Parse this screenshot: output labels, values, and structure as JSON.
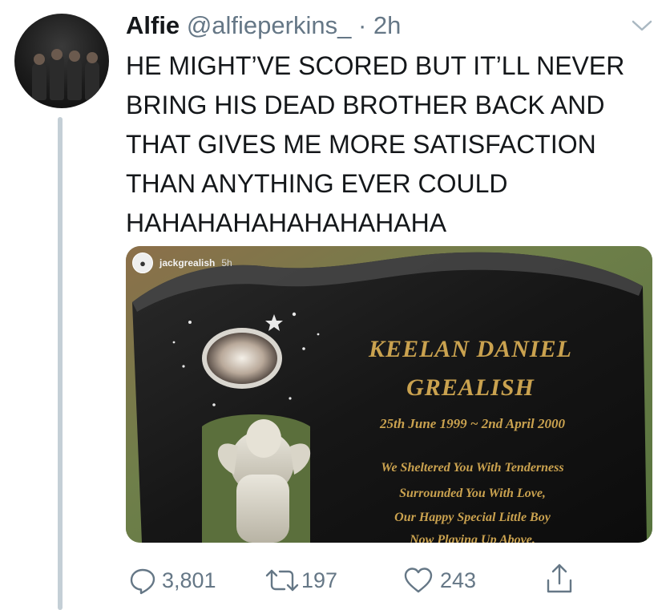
{
  "tweet": {
    "display_name": "Alfie",
    "handle": "@alfieperkins_",
    "separator": "·",
    "time": "2h",
    "text": "HE MIGHT’VE SCORED BUT IT’LL NEVER\nBRING HIS DEAD BROTHER BACK AND\nTHAT GIVES ME MORE SATISFACTION\nTHAN ANYTHING EVER COULD\nHAHAHAHAHAHAHAHAHA"
  },
  "media": {
    "instagram_user": "jackgrealish",
    "instagram_time": "5h",
    "stone": {
      "name_line1": "KEELAN DANIEL",
      "name_line2": "GREALISH",
      "dates": "25th June 1999 ~ 2nd April 2000",
      "verse1": "We Sheltered You With Tenderness",
      "verse2": "Surrounded You With Love,",
      "verse3": "Our Happy Special Little Boy",
      "verse4": "Now Playing Up Above."
    }
  },
  "actions": {
    "replies": "3,801",
    "retweets": "197",
    "likes": "243"
  },
  "colors": {
    "text": "#14171a",
    "secondary": "#657786",
    "thread_line": "#c4cfd6",
    "engraving_gold": "#caa24f"
  },
  "icons": {
    "menu": "chevron-down-icon",
    "reply": "reply-icon",
    "retweet": "retweet-icon",
    "like": "heart-icon",
    "share": "share-icon"
  }
}
